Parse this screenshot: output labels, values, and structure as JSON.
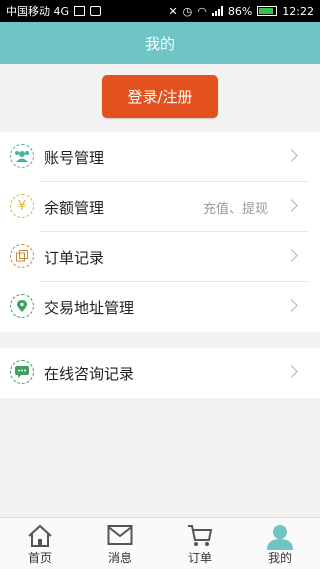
{
  "status_bar": {
    "carrier": "中国移动 4G",
    "battery": "86%",
    "time": "12:22"
  },
  "header": {
    "title": "我的"
  },
  "login": {
    "label": "登录/注册"
  },
  "menu_group_1": [
    {
      "label": "账号管理",
      "sub": "",
      "icon": "account-icon"
    },
    {
      "label": "余额管理",
      "sub": "充值、提现",
      "icon": "yen-icon"
    },
    {
      "label": "订单记录",
      "sub": "",
      "icon": "orders-icon"
    },
    {
      "label": "交易地址管理",
      "sub": "",
      "icon": "location-icon"
    }
  ],
  "menu_group_2": [
    {
      "label": "在线咨询记录",
      "sub": "",
      "icon": "chat-icon"
    }
  ],
  "bottom_nav": [
    {
      "label": "首页",
      "icon": "home-icon",
      "active": false
    },
    {
      "label": "消息",
      "icon": "message-icon",
      "active": false
    },
    {
      "label": "订单",
      "icon": "cart-icon",
      "active": false
    },
    {
      "label": "我的",
      "icon": "profile-icon",
      "active": true
    }
  ],
  "colors": {
    "header_bg": "#6fc4c4",
    "login_btn": "#e2511e",
    "accent_icon": "#3fb3a5",
    "active_tab": "#6fc4c4"
  }
}
